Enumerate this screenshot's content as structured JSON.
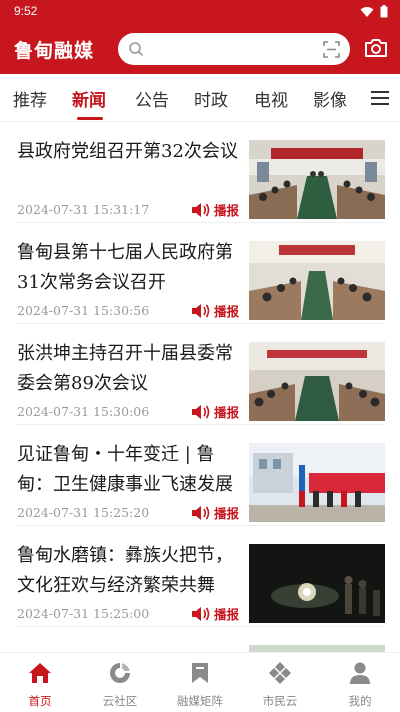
{
  "status_bar": {
    "time": "9:52"
  },
  "header": {
    "brand": "鲁甸融媒",
    "search_placeholder": ""
  },
  "tabs": [
    {
      "label": "推荐",
      "active": false
    },
    {
      "label": "新闻",
      "active": true
    },
    {
      "label": "公告",
      "active": false
    },
    {
      "label": "时政",
      "active": false
    },
    {
      "label": "电视",
      "active": false
    },
    {
      "label": "影像",
      "active": false
    }
  ],
  "news": [
    {
      "title": "县政府党组召开第32次会议",
      "time": "2024-07-31 15:31:17",
      "broadcast": "播报"
    },
    {
      "title": "鲁甸县第十七届人民政府第31次常务会议召开",
      "time": "2024-07-31 15:30:56",
      "broadcast": "播报"
    },
    {
      "title": "张洪坤主持召开十届县委常委会第89次会议",
      "time": "2024-07-31 15:30:06",
      "broadcast": "播报"
    },
    {
      "title": "见证鲁甸・十年变迁 | 鲁甸：卫生健康事业飞速发展",
      "time": "2024-07-31 15:25:20",
      "broadcast": "播报"
    },
    {
      "title": "鲁甸水磨镇：彝族火把节，文化狂欢与经济繁荣共舞",
      "time": "2024-07-31 15:25:00",
      "broadcast": "播报"
    },
    {
      "title": "",
      "time": "",
      "broadcast": ""
    }
  ],
  "bottom_nav": [
    {
      "label": "首页",
      "icon": "home-icon",
      "active": true
    },
    {
      "label": "云社区",
      "icon": "cloud-community-icon",
      "active": false
    },
    {
      "label": "融媒矩阵",
      "icon": "bookmark-icon",
      "active": false
    },
    {
      "label": "市民云",
      "icon": "diamond-grid-icon",
      "active": false
    },
    {
      "label": "我的",
      "icon": "person-icon",
      "active": false
    }
  ],
  "colors": {
    "brand_red": "#c8161e",
    "text": "#1a1a1a",
    "muted": "#999999"
  }
}
